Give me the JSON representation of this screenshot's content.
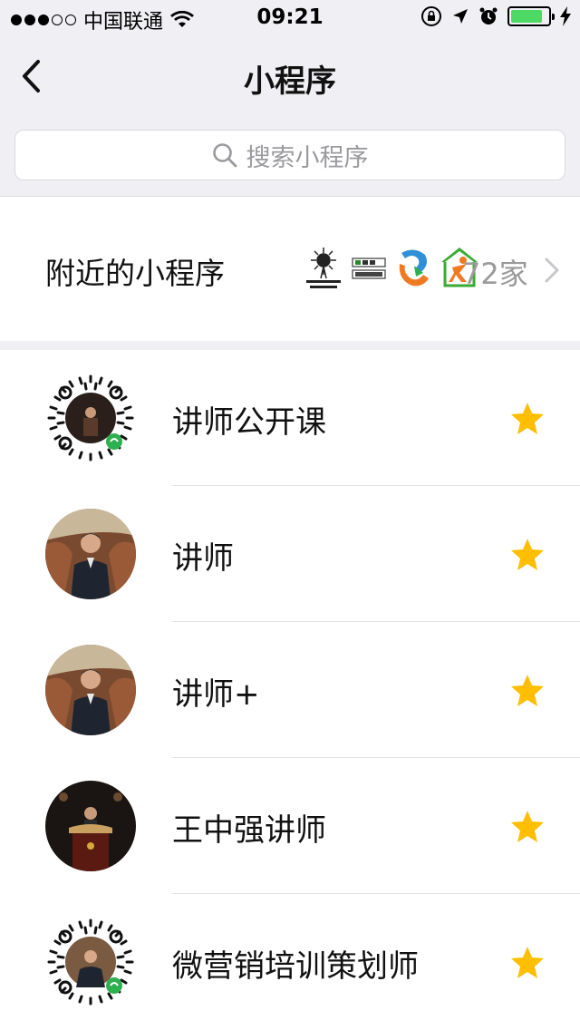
{
  "status_bar": {
    "carrier": "中国联通",
    "time": "09:21",
    "signal_bars": 3,
    "battery_level": 0.85
  },
  "nav": {
    "title": "小程序",
    "back_icon": "chevron-left-icon"
  },
  "search": {
    "placeholder": "搜索小程序",
    "icon": "search-icon"
  },
  "nearby": {
    "label": "附近的小程序",
    "count": "72家"
  },
  "mini_programs": [
    {
      "name": "讲师公开课",
      "avatar": "qr-code-avatar",
      "starred": true
    },
    {
      "name": "讲师",
      "avatar": "photo-avatar",
      "starred": true
    },
    {
      "name": "讲师+",
      "avatar": "photo-avatar",
      "starred": true
    },
    {
      "name": "王中强讲师",
      "avatar": "photo-avatar",
      "starred": true
    },
    {
      "name": "微营销培训策划师",
      "avatar": "qr-code-avatar",
      "starred": true
    }
  ],
  "colors": {
    "star": "#ffbe00",
    "background": "#efeff4",
    "battery": "#4cd964"
  }
}
